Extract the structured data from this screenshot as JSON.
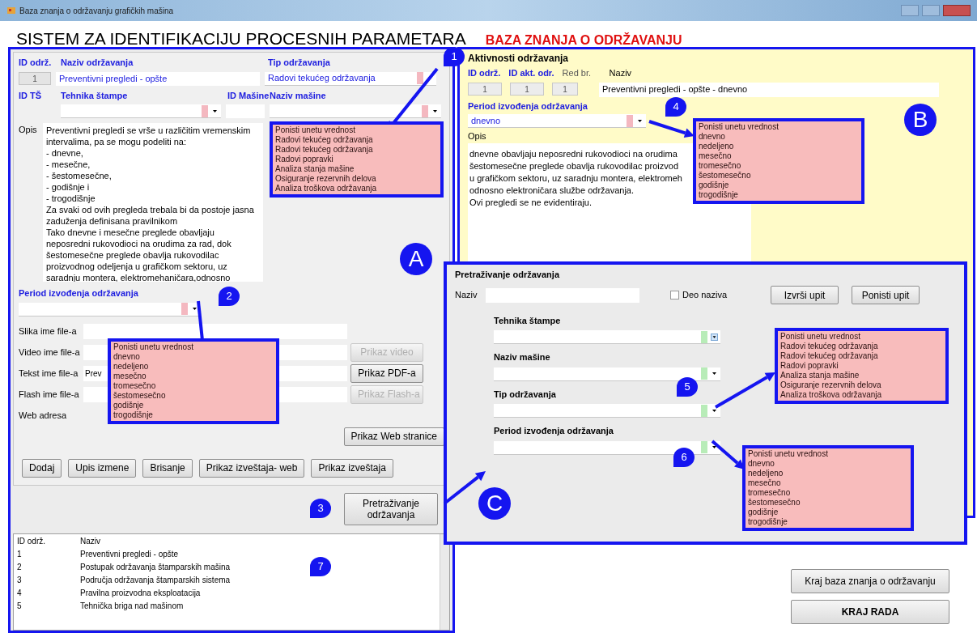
{
  "window": {
    "title": "Baza znanja o održavanju grafičkih mašina"
  },
  "header": {
    "title": "SISTEM ZA IDENTIFIKACIJU PROCESNIH PARAMETARA",
    "subtitle": "BAZA ZNANJA O ODRŽAVANJU"
  },
  "maintenance_form": {
    "id_label": "ID održ.",
    "id_value": "1",
    "name_label": "Naziv održavanja",
    "name_value": "Preventivni pregledi - opšte",
    "type_label": "Tip održavanja",
    "type_value": "Radovi tekućeg održavanja",
    "ts_label": "ID TŠ",
    "print_label": "Tehnika štampe",
    "machine_id_label": "ID Mašine",
    "machine_name_label": "Naziv mašine",
    "description_label": "Opis",
    "description": "Preventivni pregledi se vrše u različitim vremenskim\nintervalima, pa se mogu podeliti na:\n- dnevne,\n- mesečne,\n- šestomesečne,\n- godišnje i\n- trogodišnje\nZa svaki od ovih pregleda trebala bi da postoje jasna\nzaduženja definisana pravilnikom\nTako dnevne i mesečne preglede obavljaju\nneposredni rukovodioci na orudima za rad, dok\nšestomesečne preglede obavlja rukovodilac\nproizvodnog odeljenja u grafičkom sektoru, uz\nsaradnju montera, elektromehaničara,odnosno",
    "period_label": "Period izvođenja održavanja",
    "files": [
      {
        "label": "Slika ime file-a",
        "kind": "field"
      },
      {
        "label": "Video ime file-a",
        "kind": "field",
        "button": "Prikaz video",
        "disabled": true
      },
      {
        "label": "Tekst ime file-a",
        "kind": "field",
        "value": "Prev",
        "button": "Prikaz PDF-a",
        "disabled": false
      },
      {
        "label": "Flash ime file-a",
        "kind": "field",
        "button": "Prikaz Flash-a",
        "disabled": true
      },
      {
        "label": "Web adresa",
        "kind": "label"
      }
    ],
    "web_button": "Prikaz Web stranice",
    "actions": [
      "Dodaj",
      "Upis izmene",
      "Brisanje",
      "Prikaz izveštaja- web",
      "Prikaz izveštaja"
    ]
  },
  "search_button": "Pretraživanje održavanja",
  "list": {
    "columns": [
      "ID održ.",
      "Naziv"
    ],
    "rows": [
      {
        "id": "1",
        "name": "Preventivni pregledi - opšte"
      },
      {
        "id": "2",
        "name": "Postupak održavanja štamparskih mašina"
      },
      {
        "id": "3",
        "name": "Područja održavanja štamparskih sistema"
      },
      {
        "id": "4",
        "name": "Pravilna proizvodna eksploatacija"
      },
      {
        "id": "5",
        "name": "Tehnička briga nad mašinom"
      }
    ]
  },
  "activities": {
    "title": "Aktivnosti održavanja",
    "labels": [
      {
        "text": "ID održ.",
        "kind": "key"
      },
      {
        "text": "ID akt. odr.",
        "kind": "key"
      },
      {
        "text": "Red br.",
        "kind": "plain"
      }
    ],
    "values": [
      "1",
      "1",
      "1"
    ],
    "name_label": "Naziv",
    "name_value": "Preventivni pregledi - opšte - dnevno",
    "period_label": "Period izvođenja održavanja",
    "period_value": "dnevno",
    "description_label": "Opis",
    "description": "dnevne obavljaju neposredni rukovodioci na orudima\nšestomesečne preglede obavlja rukovodilac proizvod\nu grafičkom sektoru, uz saradnju montera, elektromeh\nodnosno elektroničara službe održavanja.\nOvi pregledi se ne evidentiraju."
  },
  "search": {
    "title": "Pretraživanje održavanja",
    "name_label": "Naziv",
    "partial_name": {
      "label": "Deo naziva",
      "checked": false
    },
    "buttons": [
      "Izvrši upit",
      "Ponisti upit"
    ],
    "combos": [
      "Tehnika štampe",
      "Naziv mašine",
      "Tip održavanja",
      "Period izvođenja održavanja"
    ]
  },
  "exit_buttons": [
    "Kraj baza znanja o održavanju",
    "KRAJ RADA"
  ],
  "annotations": {
    "sections": [
      "A",
      "B",
      "C"
    ],
    "callouts": [
      "1",
      "2",
      "3",
      "4",
      "5",
      "6",
      "7"
    ],
    "popups": [
      {
        "items": [
          "Ponisti unetu vrednost",
          "Radovi tekućeg održavanja",
          "Radovi tekućeg održavanja",
          "Radovi popravki",
          "Analiza stanja mašine",
          "Osiguranje rezervnih delova",
          "Analiza troškova održavanja"
        ]
      },
      {
        "items": [
          "Ponisti unetu vrednost",
          "dnevno",
          "nedeljeno",
          "mesečno",
          "tromesečno",
          "šestomesečno",
          "godišnje",
          "trogodišnje"
        ]
      },
      {
        "items": [
          "Ponisti unetu vrednost",
          "dnevno",
          "nedeljeno",
          "mesečno",
          "tromesečno",
          "šestomesečno",
          "godišnje",
          "trogodišnje"
        ]
      },
      {
        "items": [
          "Ponisti unetu vrednost",
          "Radovi tekućeg održavanja",
          "Radovi tekućeg održavanja",
          "Radovi popravki",
          "Analiza stanja mašine",
          "Osiguranje rezervnih delova",
          "Analiza troškova održavanja"
        ]
      },
      {
        "items": [
          "Ponisti unetu vrednost",
          "dnevno",
          "nedeljeno",
          "mesečno",
          "tromesečno",
          "šestomesečno",
          "godišnje",
          "trogodišnje"
        ]
      }
    ]
  }
}
